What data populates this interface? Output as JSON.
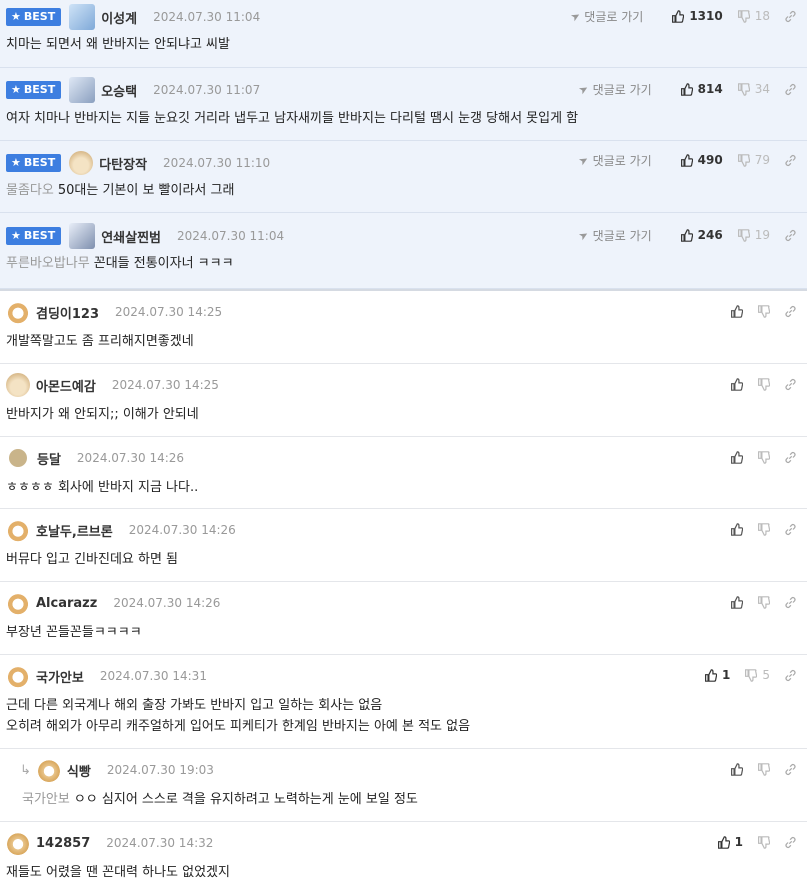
{
  "labels": {
    "best": "BEST",
    "reply_go": "댓글로 가기"
  },
  "colors": {
    "best_badge": "#3d7ee0",
    "best_bg": "#eef3fb"
  },
  "comments": [
    {
      "nick": "이성계",
      "date": "2024.07.30 11:04",
      "up": "1310",
      "down": "18",
      "text": "치마는 되면서 왜 반바지는 안되냐고 씨발"
    },
    {
      "nick": "오승택",
      "date": "2024.07.30 11:07",
      "up": "814",
      "down": "34",
      "text": "여자 치마나 반바지는 지들 눈요깃 거리라 냅두고 남자새끼들 반바지는 다리털 땜시 눈갱 당해서 못입게 함"
    },
    {
      "nick": "다탄장작",
      "date": "2024.07.30 11:10",
      "up": "490",
      "down": "79",
      "ref": "물좀다오",
      "text": "50대는 기본이 보 빨이라서 그래"
    },
    {
      "nick": "연쇄살찐범",
      "date": "2024.07.30 11:04",
      "up": "246",
      "down": "19",
      "ref": "푸른바오밥나무",
      "text": "꼰대들 전통이자너 ㅋㅋㅋ"
    },
    {
      "nick": "겸딩이123",
      "date": "2024.07.30 14:25",
      "text": "개발쪽말고도 좀 프리해지면좋겠네"
    },
    {
      "nick": "아몬드예감",
      "date": "2024.07.30 14:25",
      "text": "반바지가 왜 안되지;; 이해가 안되네"
    },
    {
      "nick": "등달",
      "date": "2024.07.30 14:26",
      "text": "ㅎㅎㅎㅎ 회사에 반바지 지금 나다.."
    },
    {
      "nick": "호날두,르브론",
      "date": "2024.07.30 14:26",
      "text": "버뮤다 입고 긴바진데요 하면 됨"
    },
    {
      "nick": "Alcarazz",
      "date": "2024.07.30 14:26",
      "text": "부장년 꼰들꼰들ㅋㅋㅋㅋ"
    },
    {
      "nick": "국가안보",
      "date": "2024.07.30 14:31",
      "up": "1",
      "down": "5",
      "text": "근데 다른 외국계나 해외 출장 가봐도 반바지 입고 일하는 회사는 없음",
      "text2": "오히려 해외가 아무리 캐주얼하게 입어도 피케티가 한계임 반바지는 아예 본 적도 없음"
    },
    {
      "nick": "식빵",
      "date": "2024.07.30 19:03",
      "ref": "국가안보",
      "text": "ㅇㅇ 심지어 스스로 격을 유지하려고 노력하는게 눈에 보일 정도"
    },
    {
      "nick": "142857",
      "date": "2024.07.30 14:32",
      "up": "1",
      "text": "재들도 어렸을 땐 꼰대력 하나도 없었겠지"
    }
  ]
}
